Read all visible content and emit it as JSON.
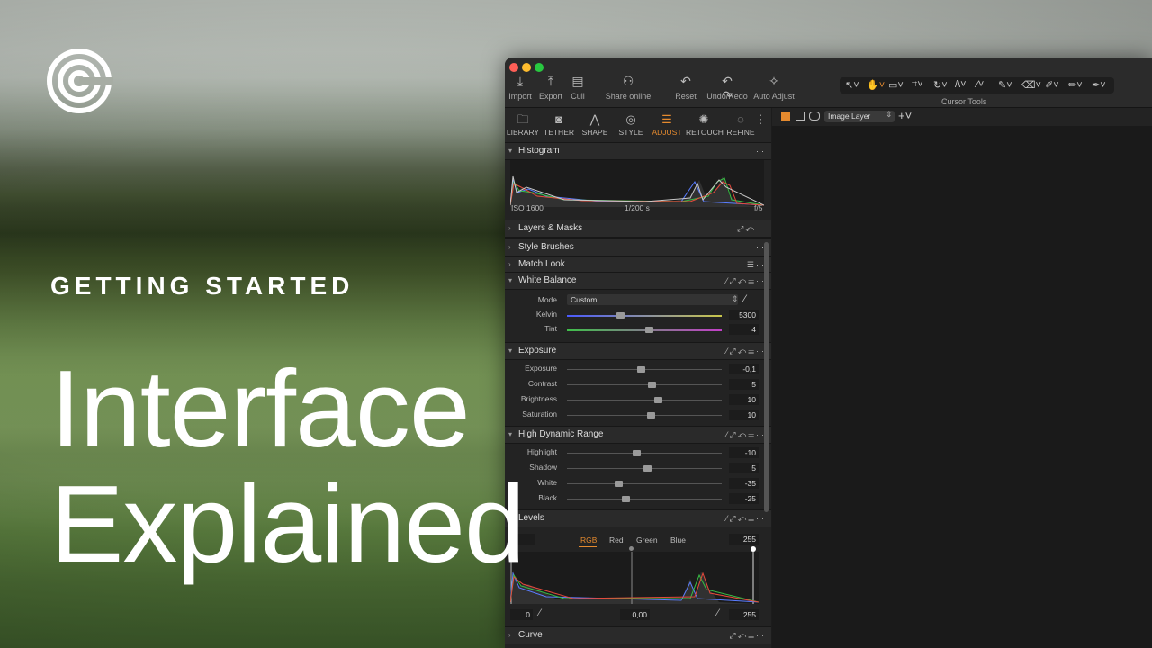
{
  "overlay": {
    "eyebrow": "GETTING STARTED",
    "headline_line1": "Interface",
    "headline_line2": "Explained"
  },
  "colors": {
    "accent": "#e58a2e",
    "close": "#ff5f57",
    "minimize": "#febc2e",
    "zoom": "#28c840"
  },
  "toolbar": {
    "buttons": [
      {
        "label": "Import",
        "icon": "import-icon"
      },
      {
        "label": "Export",
        "icon": "export-icon"
      },
      {
        "label": "Cull",
        "icon": "cull-icon"
      },
      {
        "label": "Share online",
        "icon": "share-icon"
      },
      {
        "label": "Reset",
        "icon": "reset-icon"
      },
      {
        "label": "Undo/Redo",
        "icon": "undo-redo-icon"
      },
      {
        "label": "Auto Adjust",
        "icon": "auto-adjust-icon"
      }
    ],
    "cursor_tools_label": "Cursor Tools"
  },
  "tool_tabs": [
    {
      "label": "LIBRARY",
      "icon": "folder-icon"
    },
    {
      "label": "TETHER",
      "icon": "camera-icon"
    },
    {
      "label": "SHAPE",
      "icon": "shape-icon"
    },
    {
      "label": "STYLE",
      "icon": "style-icon"
    },
    {
      "label": "ADJUST",
      "icon": "adjust-icon",
      "active": true
    },
    {
      "label": "RETOUCH",
      "icon": "retouch-icon"
    },
    {
      "label": "REFINE",
      "icon": "refine-icon"
    }
  ],
  "viewer": {
    "layer_select": "Image Layer"
  },
  "histogram": {
    "title": "Histogram",
    "iso": "ISO 1600",
    "shutter": "1/200 s",
    "aperture": "f/5"
  },
  "sections": {
    "layers_masks": "Layers & Masks",
    "style_brushes": "Style Brushes",
    "match_look": "Match Look",
    "white_balance": "White Balance",
    "exposure": "Exposure",
    "hdr": "High Dynamic Range",
    "levels": "Levels",
    "curve": "Curve"
  },
  "white_balance": {
    "mode_label": "Mode",
    "mode_value": "Custom",
    "kelvin_label": "Kelvin",
    "kelvin_value": "5300",
    "tint_label": "Tint",
    "tint_value": "4"
  },
  "exposure": {
    "rows": [
      {
        "label": "Exposure",
        "value": "-0,1"
      },
      {
        "label": "Contrast",
        "value": "5"
      },
      {
        "label": "Brightness",
        "value": "10"
      },
      {
        "label": "Saturation",
        "value": "10"
      }
    ]
  },
  "hdr": {
    "rows": [
      {
        "label": "Highlight",
        "value": "-10"
      },
      {
        "label": "Shadow",
        "value": "5"
      },
      {
        "label": "White",
        "value": "-35"
      },
      {
        "label": "Black",
        "value": "-25"
      }
    ]
  },
  "levels": {
    "tabs": [
      "RGB",
      "Red",
      "Green",
      "Blue"
    ],
    "input_low": "0",
    "input_high": "255",
    "output_low": "0",
    "midtone": "0,00",
    "output_high": "255"
  }
}
